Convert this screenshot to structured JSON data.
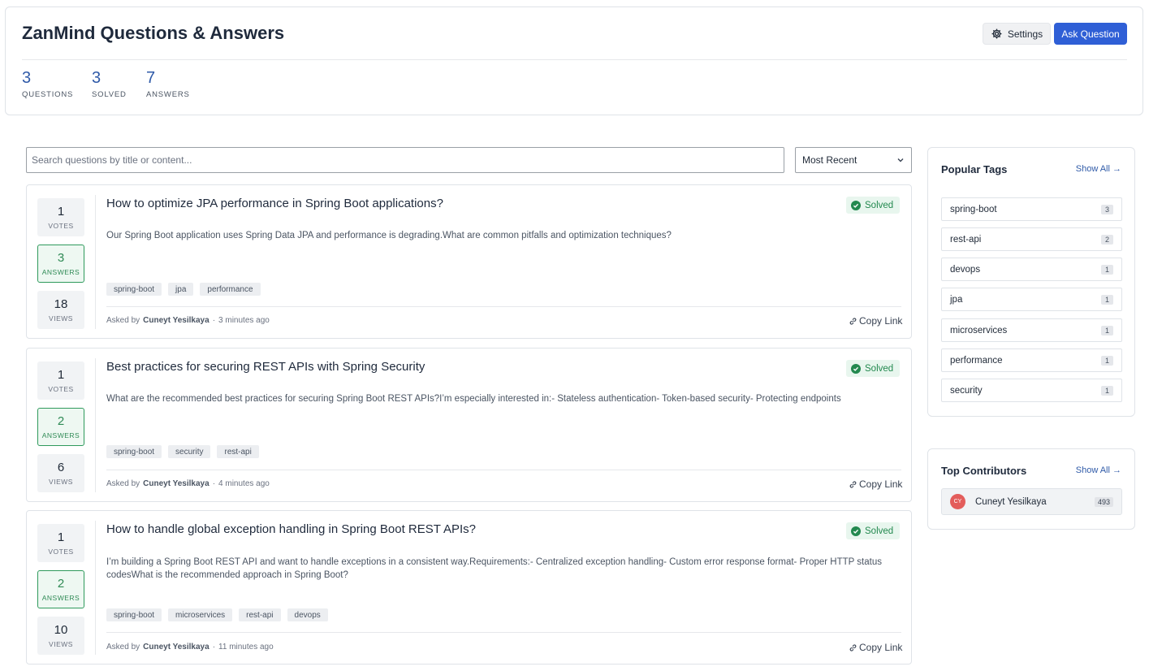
{
  "header": {
    "title": "ZanMind Questions & Answers",
    "settings_label": "Settings",
    "ask_label": "Ask Question",
    "stats": [
      {
        "value": "3",
        "label": "QUESTIONS"
      },
      {
        "value": "3",
        "label": "SOLVED"
      },
      {
        "value": "7",
        "label": "ANSWERS"
      }
    ]
  },
  "search": {
    "placeholder": "Search questions by title or content..."
  },
  "sort": {
    "selected": "Most Recent"
  },
  "questions": [
    {
      "votes": "1",
      "votes_label": "VOTES",
      "answers": "3",
      "answers_label": "ANSWERS",
      "views": "18",
      "views_label": "VIEWS",
      "title": "How to optimize JPA performance in Spring Boot applications?",
      "status": "Solved",
      "body": "Our Spring Boot application uses Spring Data JPA and performance is degrading.What are common pitfalls and optimization techniques?",
      "tags": [
        "spring-boot",
        "jpa",
        "performance"
      ],
      "asked_by_label": "Asked by",
      "author": "Cuneyt Yesilkaya",
      "time": "3 minutes ago",
      "copy_label": "Copy Link"
    },
    {
      "votes": "1",
      "votes_label": "VOTES",
      "answers": "2",
      "answers_label": "ANSWERS",
      "views": "6",
      "views_label": "VIEWS",
      "title": "Best practices for securing REST APIs with Spring Security",
      "status": "Solved",
      "body": "What are the recommended best practices for securing Spring Boot REST APIs?I’m especially interested in:- Stateless authentication- Token-based security- Protecting endpoints",
      "tags": [
        "spring-boot",
        "security",
        "rest-api"
      ],
      "asked_by_label": "Asked by",
      "author": "Cuneyt Yesilkaya",
      "time": "4 minutes ago",
      "copy_label": "Copy Link"
    },
    {
      "votes": "1",
      "votes_label": "VOTES",
      "answers": "2",
      "answers_label": "ANSWERS",
      "views": "10",
      "views_label": "VIEWS",
      "title": "How to handle global exception handling in Spring Boot REST APIs?",
      "status": "Solved",
      "body": "I’m building a Spring Boot REST API and want to handle exceptions in a consistent way.Requirements:- Centralized exception handling- Custom error response format- Proper HTTP status codesWhat is the recommended approach in Spring Boot?",
      "tags": [
        "spring-boot",
        "microservices",
        "rest-api",
        "devops"
      ],
      "asked_by_label": "Asked by",
      "author": "Cuneyt Yesilkaya",
      "time": "11 minutes ago",
      "copy_label": "Copy Link"
    }
  ],
  "popular_tags": {
    "title": "Popular Tags",
    "show_all": "Show All →",
    "items": [
      {
        "name": "spring-boot",
        "count": "3"
      },
      {
        "name": "rest-api",
        "count": "2"
      },
      {
        "name": "devops",
        "count": "1"
      },
      {
        "name": "jpa",
        "count": "1"
      },
      {
        "name": "microservices",
        "count": "1"
      },
      {
        "name": "performance",
        "count": "1"
      },
      {
        "name": "security",
        "count": "1"
      }
    ]
  },
  "top_contributors": {
    "title": "Top Contributors",
    "show_all": "Show All →",
    "items": [
      {
        "initials": "CY",
        "name": "Cuneyt Yesilkaya",
        "score": "493"
      }
    ]
  }
}
